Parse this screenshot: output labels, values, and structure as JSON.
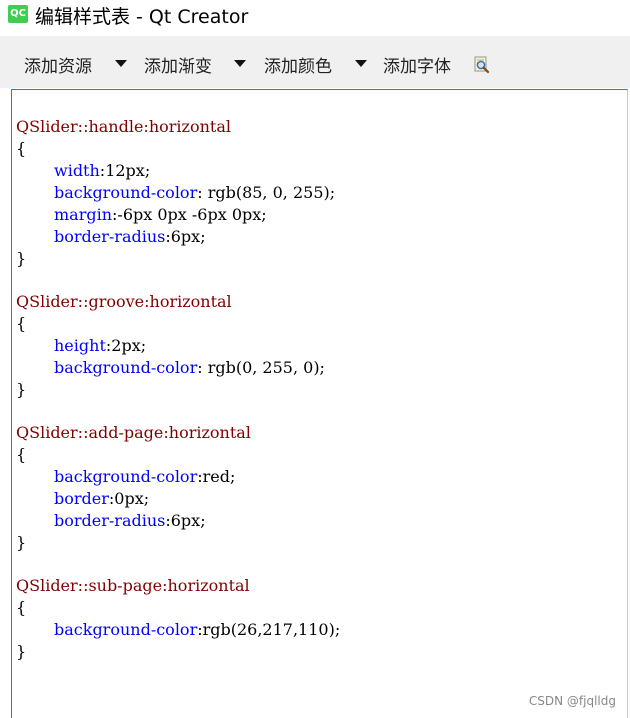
{
  "window": {
    "app_icon_text": "QC",
    "title": "编辑样式表 - Qt Creator"
  },
  "toolbar": {
    "add_resource": "添加资源",
    "add_gradient": "添加渐变",
    "add_color": "添加颜色",
    "add_font": "添加字体",
    "find_icon": "find-icon"
  },
  "editor": {
    "lines": [
      {
        "tokens": [
          {
            "type": "selector",
            "text": "QSlider::handle:horizontal"
          }
        ]
      },
      {
        "tokens": [
          {
            "type": "brace",
            "text": "{"
          }
        ]
      },
      {
        "tokens": [
          {
            "type": "property",
            "text": "width"
          },
          {
            "type": "value",
            "text": ":12px;"
          }
        ]
      },
      {
        "tokens": [
          {
            "type": "property",
            "text": "background-color"
          },
          {
            "type": "value",
            "text": ": rgb(85, 0, 255);"
          }
        ]
      },
      {
        "tokens": [
          {
            "type": "property",
            "text": "margin"
          },
          {
            "type": "value",
            "text": ":-6px 0px -6px 0px;"
          }
        ]
      },
      {
        "tokens": [
          {
            "type": "property",
            "text": "border-radius"
          },
          {
            "type": "value",
            "text": ":6px;"
          }
        ]
      },
      {
        "tokens": [
          {
            "type": "brace",
            "text": "}"
          }
        ]
      },
      {
        "tokens": [
          {
            "type": "selector",
            "text": "QSlider::groove:horizontal"
          }
        ]
      },
      {
        "tokens": [
          {
            "type": "brace",
            "text": "{"
          }
        ]
      },
      {
        "tokens": [
          {
            "type": "property",
            "text": "height"
          },
          {
            "type": "value",
            "text": ":2px;"
          }
        ]
      },
      {
        "tokens": [
          {
            "type": "property",
            "text": "background-color"
          },
          {
            "type": "value",
            "text": ": rgb(0, 255, 0);"
          }
        ]
      },
      {
        "tokens": [
          {
            "type": "brace",
            "text": "}"
          }
        ]
      },
      {
        "tokens": [
          {
            "type": "selector",
            "text": "QSlider::add-page:horizontal"
          }
        ]
      },
      {
        "tokens": [
          {
            "type": "brace",
            "text": "{"
          }
        ]
      },
      {
        "tokens": [
          {
            "type": "property",
            "text": "background-color"
          },
          {
            "type": "value",
            "text": ":red;"
          }
        ]
      },
      {
        "tokens": [
          {
            "type": "property",
            "text": "border"
          },
          {
            "type": "value",
            "text": ":0px;"
          }
        ]
      },
      {
        "tokens": [
          {
            "type": "property",
            "text": "border-radius"
          },
          {
            "type": "value",
            "text": ":6px;"
          }
        ]
      },
      {
        "tokens": [
          {
            "type": "brace",
            "text": "}"
          }
        ]
      },
      {
        "tokens": [
          {
            "type": "selector",
            "text": "QSlider::sub-page:horizontal"
          }
        ]
      },
      {
        "tokens": [
          {
            "type": "brace",
            "text": "{"
          }
        ]
      },
      {
        "tokens": [
          {
            "type": "property",
            "text": "background-color"
          },
          {
            "type": "value",
            "text": ":rgb(26,217,110);"
          }
        ]
      },
      {
        "tokens": [
          {
            "type": "brace",
            "text": "}"
          }
        ]
      }
    ]
  },
  "watermark": "CSDN @fjqlldg",
  "colors": {
    "selector": "#800000",
    "property": "#0000ff",
    "value": "#000000",
    "editor_focus_border": "#2f7ad1",
    "toolbar_bg": "#f0f0f0",
    "app_icon_bg": "#41cd52"
  }
}
